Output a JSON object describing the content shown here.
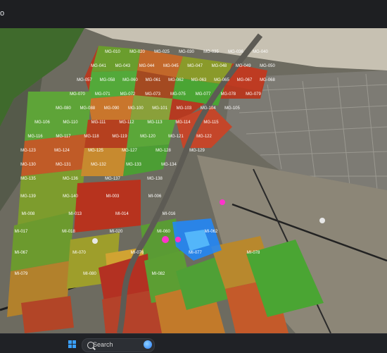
{
  "window": {
    "title_fragment": "o"
  },
  "taskbar": {
    "search_label": "Search"
  },
  "map": {
    "field_labels": [
      "MG-010",
      "MG-020",
      "MG-025",
      "MG-030",
      "MG-035",
      "MG-036",
      "MG-040",
      "MG-041",
      "MG-043",
      "MG-044",
      "MG-045",
      "MG-047",
      "MG-048",
      "MG-049",
      "MG-050",
      "MG-057",
      "MG-058",
      "MG-060",
      "MG-061",
      "MG-062",
      "MG-063",
      "MG-065",
      "MG-067",
      "MG-068",
      "MG-070",
      "MG-071",
      "MG-072",
      "MG-073",
      "MG-075",
      "MG-077",
      "MG-078",
      "MG-079",
      "MG-080",
      "MG-088",
      "MG-090",
      "MG-100",
      "MG-101",
      "MG-103",
      "MG-104",
      "MG-105",
      "MG-106",
      "MG-110",
      "MG-111",
      "MG-112",
      "MG-113",
      "MG-114",
      "MG-115",
      "MG-116",
      "MG-117",
      "MG-118",
      "MG-119",
      "MG-120",
      "MG-121",
      "MG-122",
      "MG-123",
      "MG-124",
      "MG-125",
      "MG-127",
      "MG-128",
      "MG-129",
      "MG-130",
      "MG-131",
      "MG-132",
      "MG-133",
      "MG-134",
      "MG-135",
      "MG-136",
      "MG-137",
      "MG-138",
      "MG-139",
      "MG-140",
      "MI-003",
      "MI-006",
      "MI-008",
      "MI-013",
      "MI-014",
      "MI-016",
      "MI-017",
      "MI-018",
      "MI-020",
      "MI-060",
      "MI-062",
      "MI-067",
      "MI-070",
      "MI-076",
      "MI-077",
      "MI-078",
      "MI-079",
      "MI-080",
      "MI-082"
    ],
    "accent_colors": {
      "pin": "#ff33cc",
      "zone_blue": "#1e88ff",
      "field_green": "#3f9f2f",
      "field_red": "#b4331f"
    }
  }
}
